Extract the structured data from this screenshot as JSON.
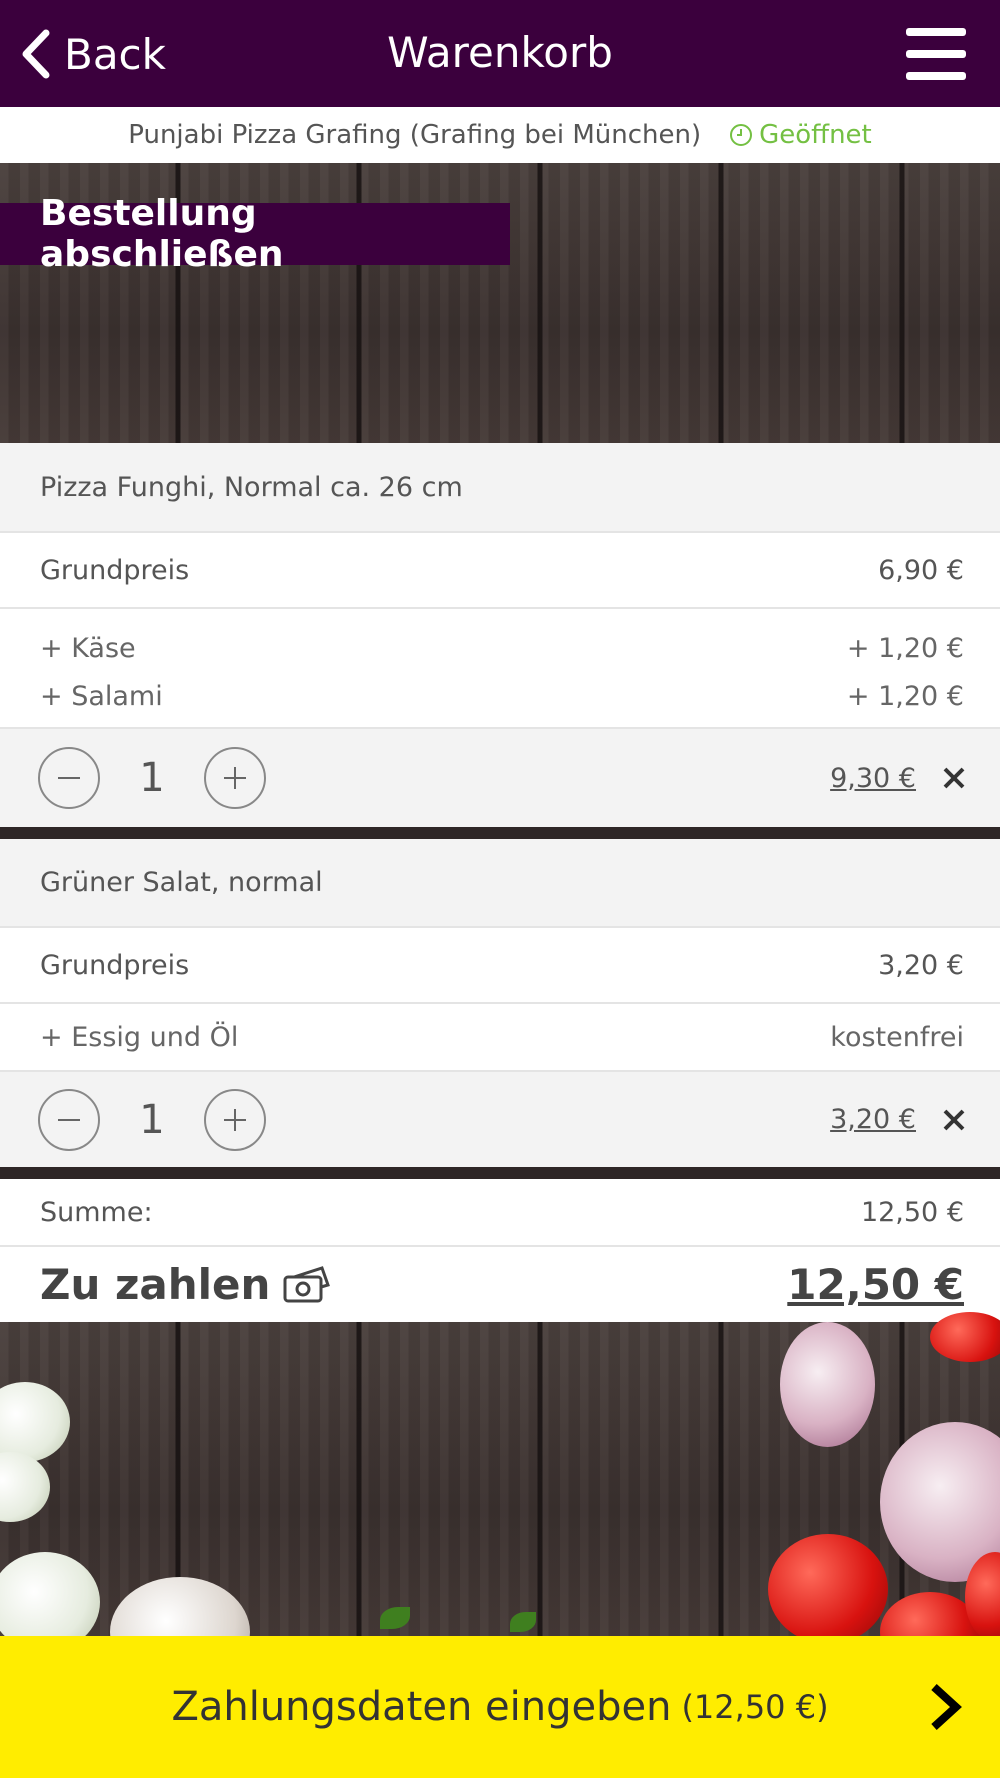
{
  "header": {
    "back_label": "Back",
    "title": "Warenkorb"
  },
  "restaurant": {
    "name": "Punjabi Pizza Grafing (Grafing bei München)",
    "status": "Geöffnet"
  },
  "section_title": "Bestellung abschließen",
  "cart": {
    "items": [
      {
        "title": "Pizza Funghi, Normal ca. 26 cm",
        "base_label": "Grundpreis",
        "base_price": "6,90 €",
        "extras": [
          {
            "name": "+ Käse",
            "price": "+ 1,20 €"
          },
          {
            "name": "+ Salami",
            "price": "+ 1,20 €"
          }
        ],
        "quantity": "1",
        "line_total": "9,30 €"
      },
      {
        "title": "Grüner Salat, normal",
        "base_label": "Grundpreis",
        "base_price": "3,20 €",
        "extras": [
          {
            "name": "+ Essig und Öl",
            "price": "kostenfrei"
          }
        ],
        "quantity": "1",
        "line_total": "3,20 €"
      }
    ],
    "sum_label": "Summe:",
    "sum_value": "12,50 €",
    "pay_label": "Zu zahlen",
    "pay_value": "12,50 €"
  },
  "cta": {
    "label": "Zahlungsdaten eingeben",
    "amount": "(12,50 €)"
  },
  "icons": {
    "back": "chevron-left-icon",
    "menu": "hamburger-menu-icon",
    "status": "clock-icon",
    "minus": "minus-icon",
    "plus": "plus-icon",
    "remove": "close-icon",
    "money": "money-icon",
    "forward": "chevron-right-icon"
  },
  "colors": {
    "header_bg": "#3b003d",
    "open_status": "#74c043",
    "cta_bg": "#ffed00"
  }
}
